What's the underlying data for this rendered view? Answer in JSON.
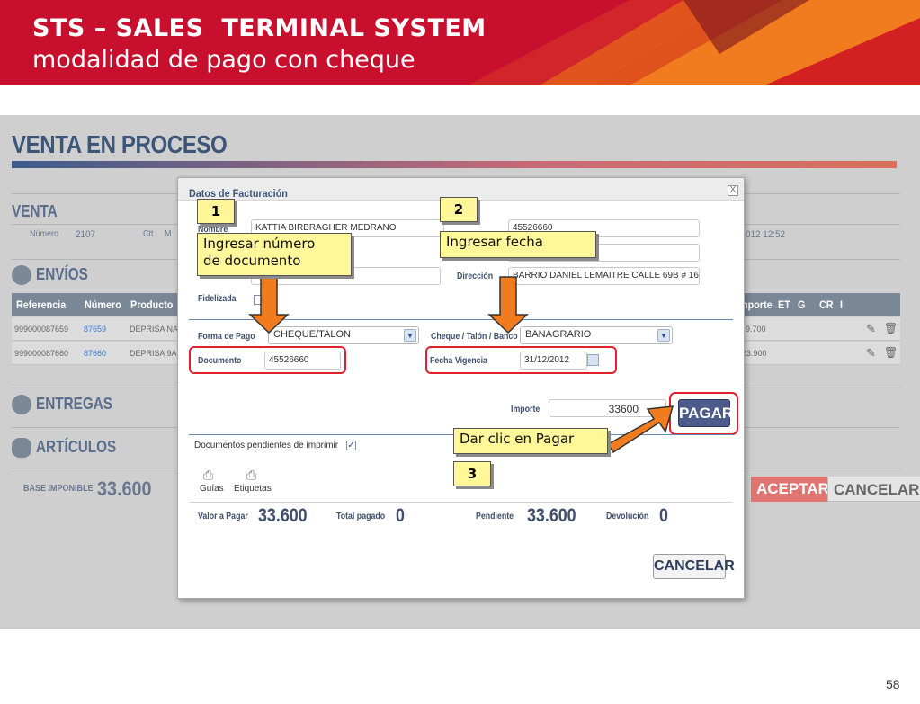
{
  "banner": {
    "title": "STS – SALES  TERMINAL SYSTEM",
    "subtitle": "modalidad de pago con cheque"
  },
  "app": {
    "page_title": "VENTA EN PROCESO",
    "venta": {
      "heading": "VENTA",
      "numero_label": "Número",
      "numero_value": "2107",
      "ctt_label": "Ctt",
      "m_label": "M",
      "datetime": "012 12:52"
    },
    "envios": {
      "heading": "ENVÍOS",
      "columns_left": [
        "Referencia",
        "Número",
        "Producto"
      ],
      "columns_right": [
        "nporte",
        "ET",
        "G",
        "CR",
        "I"
      ],
      "rows": [
        {
          "referencia": "999000087659",
          "numero": "87659",
          "producto": "DEPRISA NA",
          "importe": "9.700"
        },
        {
          "referencia": "999000087660",
          "numero": "87660",
          "producto": "DEPRISA 9A",
          "importe": "23.900"
        }
      ]
    },
    "entregas": {
      "heading": "ENTREGAS"
    },
    "articulos": {
      "heading": "ARTÍCULOS"
    },
    "base": {
      "label": "BASE IMPONIBLE",
      "value": "33.600"
    },
    "aceptar_label": "ACEPTAR",
    "cancelar_label": "CANCELAR"
  },
  "dialog": {
    "title": "Datos de Facturación",
    "close": "X",
    "fields": {
      "nombre_label": "Nombre",
      "nombre_value": "KATTIA BIRBRAGHER MEDRANO",
      "documento_top_value": "45526660",
      "direccion_label": "Dirección",
      "direccion_value": "BARRIO DANIEL LEMAITRE CALLE 69B # 16 #",
      "fidelizada_label": "Fidelizada",
      "forma_pago_label": "Forma de Pago",
      "forma_pago_value": "CHEQUE/TALON",
      "cheque_label": "Cheque / Talón / Banco",
      "cheque_value": "BANAGRARIO",
      "documento_label": "Documento",
      "documento_value": "45526660",
      "fecha_label": "Fecha Vigencia",
      "fecha_value": "31/12/2012",
      "importe_label": "Importe",
      "importe_value": "33600"
    },
    "pagar_label": "PAGAR",
    "pendientes_label": "Documentos pendientes de imprimir",
    "print_items": [
      "Guías",
      "Etiquetas"
    ],
    "totals": {
      "valor_label": "Valor a Pagar",
      "valor_value": "33.600",
      "total_label": "Total pagado",
      "total_value": "0",
      "pendiente_label": "Pendiente",
      "pendiente_value": "33.600",
      "devolucion_label": "Devolución",
      "devolucion_value": "0"
    },
    "cancelar_label": "CANCELAR"
  },
  "callouts": {
    "step1_num": "1",
    "step1_line1": "Ingresar número",
    "step1_line2": "de documento",
    "step2_num": "2",
    "step2_text": "Ingresar fecha",
    "step3_num": "3",
    "step3_text": "Dar clic en Pagar"
  },
  "page_number": "58",
  "colors": {
    "brand_red": "#c8102e",
    "callout_yellow": "#fff799",
    "arrow_orange": "#f07c1f",
    "highlight_red": "#e0202a"
  }
}
